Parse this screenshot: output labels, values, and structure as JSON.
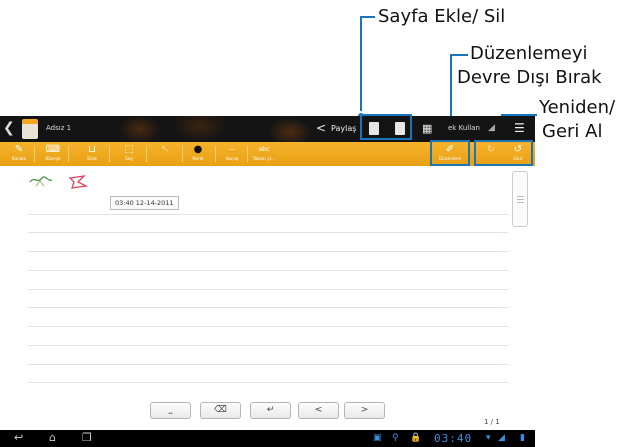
{
  "annotations": {
    "add_delete_page": "Sayfa Ekle/ Sil",
    "disable_editing_line1": "Düzenlemeyi",
    "disable_editing_line2": "Devre Dışı Bırak",
    "redo_undo_line1": "Yeniden/",
    "redo_undo_line2": "Geri Al",
    "accent_color": "#1a75bb"
  },
  "topbar": {
    "back_icon": "back-arrow-icon",
    "doc_title": "Adsız 1",
    "share_label": "Paylaş",
    "tool_label": "ek Kullan",
    "menu_icon": "menu-icon"
  },
  "toolbar": {
    "items": [
      {
        "label": "Karala",
        "icon": "pen-scribble-icon"
      },
      {
        "label": "Klavye",
        "icon": "keyboard-icon"
      },
      {
        "label": "Ekle",
        "icon": "insert-icon"
      },
      {
        "label": "Seç",
        "icon": "select-icon"
      },
      {
        "label": "",
        "icon": "cursor-icon"
      },
      {
        "label": "Renk",
        "icon": "color-dot-icon"
      },
      {
        "label": "Vuruş",
        "icon": "stroke-icon"
      },
      {
        "label": "Taban çi...",
        "icon": "baseline-icon"
      }
    ],
    "edit_label": "Düzenlem",
    "undo_label": "Geri",
    "bar_color": "#f0a91f"
  },
  "note": {
    "timestamp": "03:40 12-14-2011"
  },
  "keyboard_buttons": [
    "space",
    "backspace",
    "enter",
    "<",
    ">"
  ],
  "page_number": "1 / 1",
  "navbar": {
    "clock": "03:40"
  }
}
